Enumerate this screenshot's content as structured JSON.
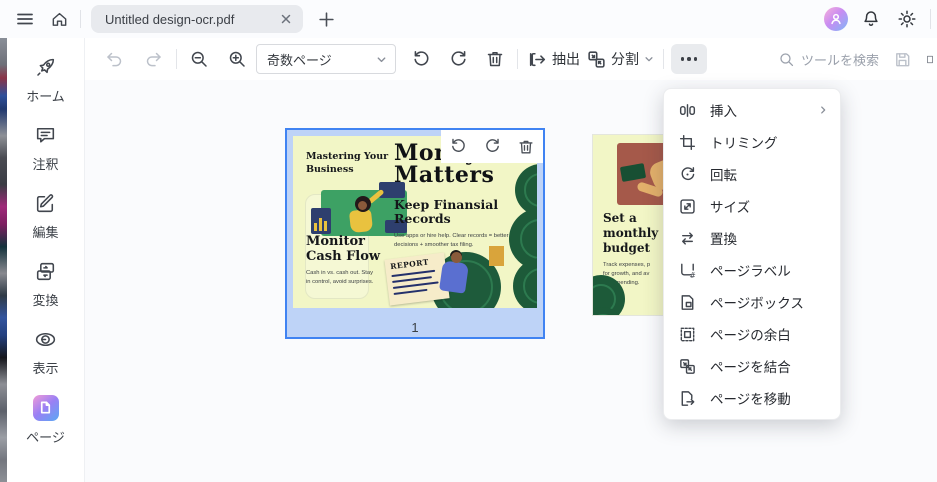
{
  "topbar": {
    "tab_title": "Untitled design-ocr.pdf"
  },
  "toolbar": {
    "page_filter_value": "奇数ページ",
    "extract_label": "抽出",
    "split_label": "分割",
    "search_placeholder": "ツールを検索"
  },
  "sidebar": {
    "items": [
      {
        "label": "ホーム",
        "icon": "rocket-icon",
        "active": false
      },
      {
        "label": "注釈",
        "icon": "comment-icon",
        "active": false
      },
      {
        "label": "編集",
        "icon": "edit-icon",
        "active": false
      },
      {
        "label": "変換",
        "icon": "convert-icon",
        "active": false
      },
      {
        "label": "表示",
        "icon": "eye-icon",
        "active": false
      },
      {
        "label": "ページ",
        "icon": "page-gradient-icon",
        "active": true
      }
    ]
  },
  "menu": {
    "items": [
      {
        "label": "挿入",
        "icon": "insert-page-icon",
        "submenu": true
      },
      {
        "label": "トリミング",
        "icon": "crop-icon",
        "submenu": false
      },
      {
        "label": "回転",
        "icon": "rotate-icon",
        "submenu": false
      },
      {
        "label": "サイズ",
        "icon": "resize-icon",
        "submenu": false
      },
      {
        "label": "置換",
        "icon": "replace-icon",
        "submenu": false
      },
      {
        "label": "ページラベル",
        "icon": "page-label-icon",
        "submenu": false
      },
      {
        "label": "ページボックス",
        "icon": "page-box-icon",
        "submenu": false
      },
      {
        "label": "ページの余白",
        "icon": "page-margin-icon",
        "submenu": false
      },
      {
        "label": "ページを結合",
        "icon": "merge-pages-icon",
        "submenu": false
      },
      {
        "label": "ページを移動",
        "icon": "move-page-icon",
        "submenu": false
      }
    ]
  },
  "pages": [
    {
      "number": "1",
      "selected": true,
      "poster": {
        "kicker": "Mastering Your Business",
        "title_line1": "Money",
        "title_line2": "Matters",
        "sub1": "Keep Finansial Records",
        "body1": "Use apps or hire help. Clear records = better decisions + smoother tax filing.",
        "sub2": "Monitor Cash Flow",
        "body2": "Cash in vs. cash out. Stay in control, avoid surprises.",
        "report_label": "REPORT"
      }
    },
    {
      "selected": false,
      "poster": {
        "heading": "Set a monthly budget",
        "body_line1": "Track expenses, p",
        "body_line2": "for growth, and av",
        "body_line3": "overspending."
      }
    }
  ],
  "colors": {
    "accent_blue": "#4083f2",
    "selection_fill": "#bed3f7",
    "poster_bg": "#f2f6c6",
    "foliage_green": "#1d5a39",
    "panel_green": "#3da164",
    "brick": "#a5594a",
    "menu_bg": "#ffffff",
    "avatar_gradient": "linear pink-purple-blue"
  }
}
